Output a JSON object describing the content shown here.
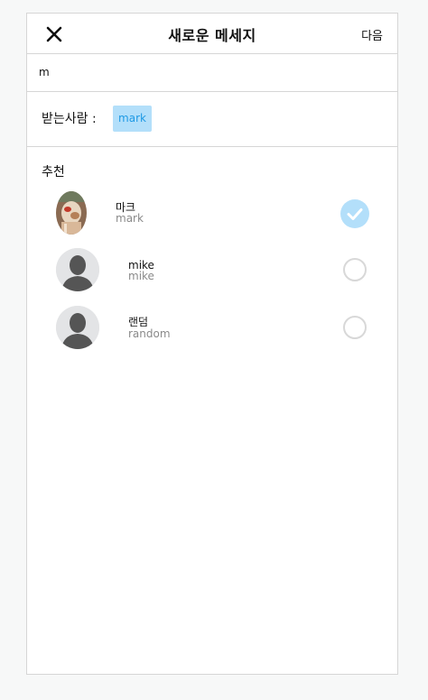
{
  "header": {
    "title": "새로운 메세지",
    "next_label": "다음"
  },
  "search": {
    "value": "m"
  },
  "recipients": {
    "label": "받는사람 :",
    "chips": [
      "mark"
    ]
  },
  "suggestions": {
    "title": "추천",
    "items": [
      {
        "name": "마크",
        "username": "mark",
        "selected": true,
        "avatar": "photo"
      },
      {
        "name": "mike",
        "username": "mike",
        "selected": false,
        "avatar": "default-silhouette"
      },
      {
        "name": "랜덤",
        "username": "random",
        "selected": false,
        "avatar": "default-silhouette"
      }
    ]
  },
  "colors": {
    "accent": "#b3dffa",
    "chip_text": "#1f9ae5",
    "border": "#d6d6d6"
  }
}
